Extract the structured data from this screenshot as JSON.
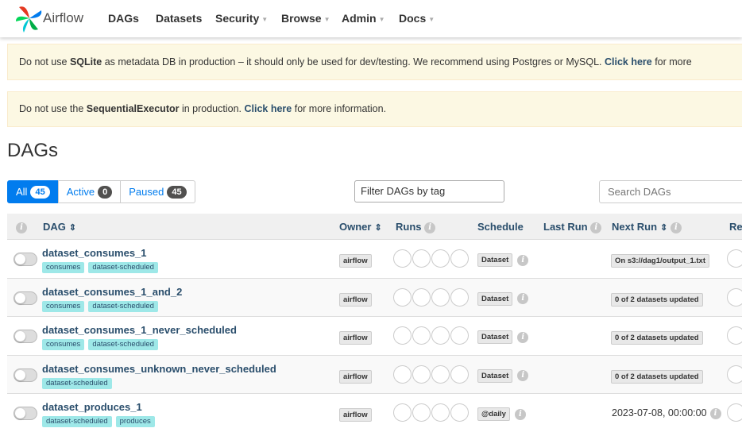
{
  "navbar": {
    "brand": "Airflow",
    "items": [
      {
        "label": "DAGs",
        "has_dropdown": false
      },
      {
        "label": "Datasets",
        "has_dropdown": false
      },
      {
        "label": "Security",
        "has_dropdown": true
      },
      {
        "label": "Browse",
        "has_dropdown": true
      },
      {
        "label": "Admin",
        "has_dropdown": true
      },
      {
        "label": "Docs",
        "has_dropdown": true
      }
    ]
  },
  "alerts": [
    {
      "pre": "Do not use ",
      "bold": "SQLite",
      "mid": " as metadata DB in production – it should only be used for dev/testing. We recommend using Postgres or MySQL. ",
      "link": "Click here",
      "post": " for more information."
    },
    {
      "pre": "Do not use the ",
      "bold": "SequentialExecutor",
      "mid": " in production. ",
      "link": "Click here",
      "post": " for more information."
    }
  ],
  "page_title": "DAGs",
  "filters": {
    "all": {
      "label": "All",
      "count": "45"
    },
    "active": {
      "label": "Active",
      "count": "0"
    },
    "paused": {
      "label": "Paused",
      "count": "45"
    }
  },
  "tag_filter_placeholder": "Filter DAGs by tag",
  "search_placeholder": "Search DAGs",
  "table": {
    "headers": {
      "dag": "DAG",
      "owner": "Owner",
      "runs": "Runs",
      "schedule": "Schedule",
      "last_run": "Last Run",
      "next_run": "Next Run",
      "recent": "Re"
    },
    "rows": [
      {
        "name": "dataset_consumes_1",
        "tags": [
          "consumes",
          "dataset-scheduled"
        ],
        "owner": "airflow",
        "schedule": "Dataset",
        "next_run": "On s3://dag1/output_1.txt",
        "next_run_style": "label"
      },
      {
        "name": "dataset_consumes_1_and_2",
        "tags": [
          "consumes",
          "dataset-scheduled"
        ],
        "owner": "airflow",
        "schedule": "Dataset",
        "next_run": "0 of 2 datasets updated",
        "next_run_style": "label"
      },
      {
        "name": "dataset_consumes_1_never_scheduled",
        "tags": [
          "consumes",
          "dataset-scheduled"
        ],
        "owner": "airflow",
        "schedule": "Dataset",
        "next_run": "0 of 2 datasets updated",
        "next_run_style": "label"
      },
      {
        "name": "dataset_consumes_unknown_never_scheduled",
        "tags": [
          "dataset-scheduled"
        ],
        "owner": "airflow",
        "schedule": "Dataset",
        "next_run": "0 of 2 datasets updated",
        "next_run_style": "label"
      },
      {
        "name": "dataset_produces_1",
        "tags": [
          "dataset-scheduled",
          "produces"
        ],
        "owner": "airflow",
        "schedule": "@daily",
        "next_run": "2023-07-08, 00:00:00",
        "next_run_style": "text"
      }
    ]
  },
  "colors": {
    "accent": "#017cee",
    "link": "#2a4e6c",
    "tag": "#9ee8e8",
    "alert_bg": "#fcf8e3"
  }
}
